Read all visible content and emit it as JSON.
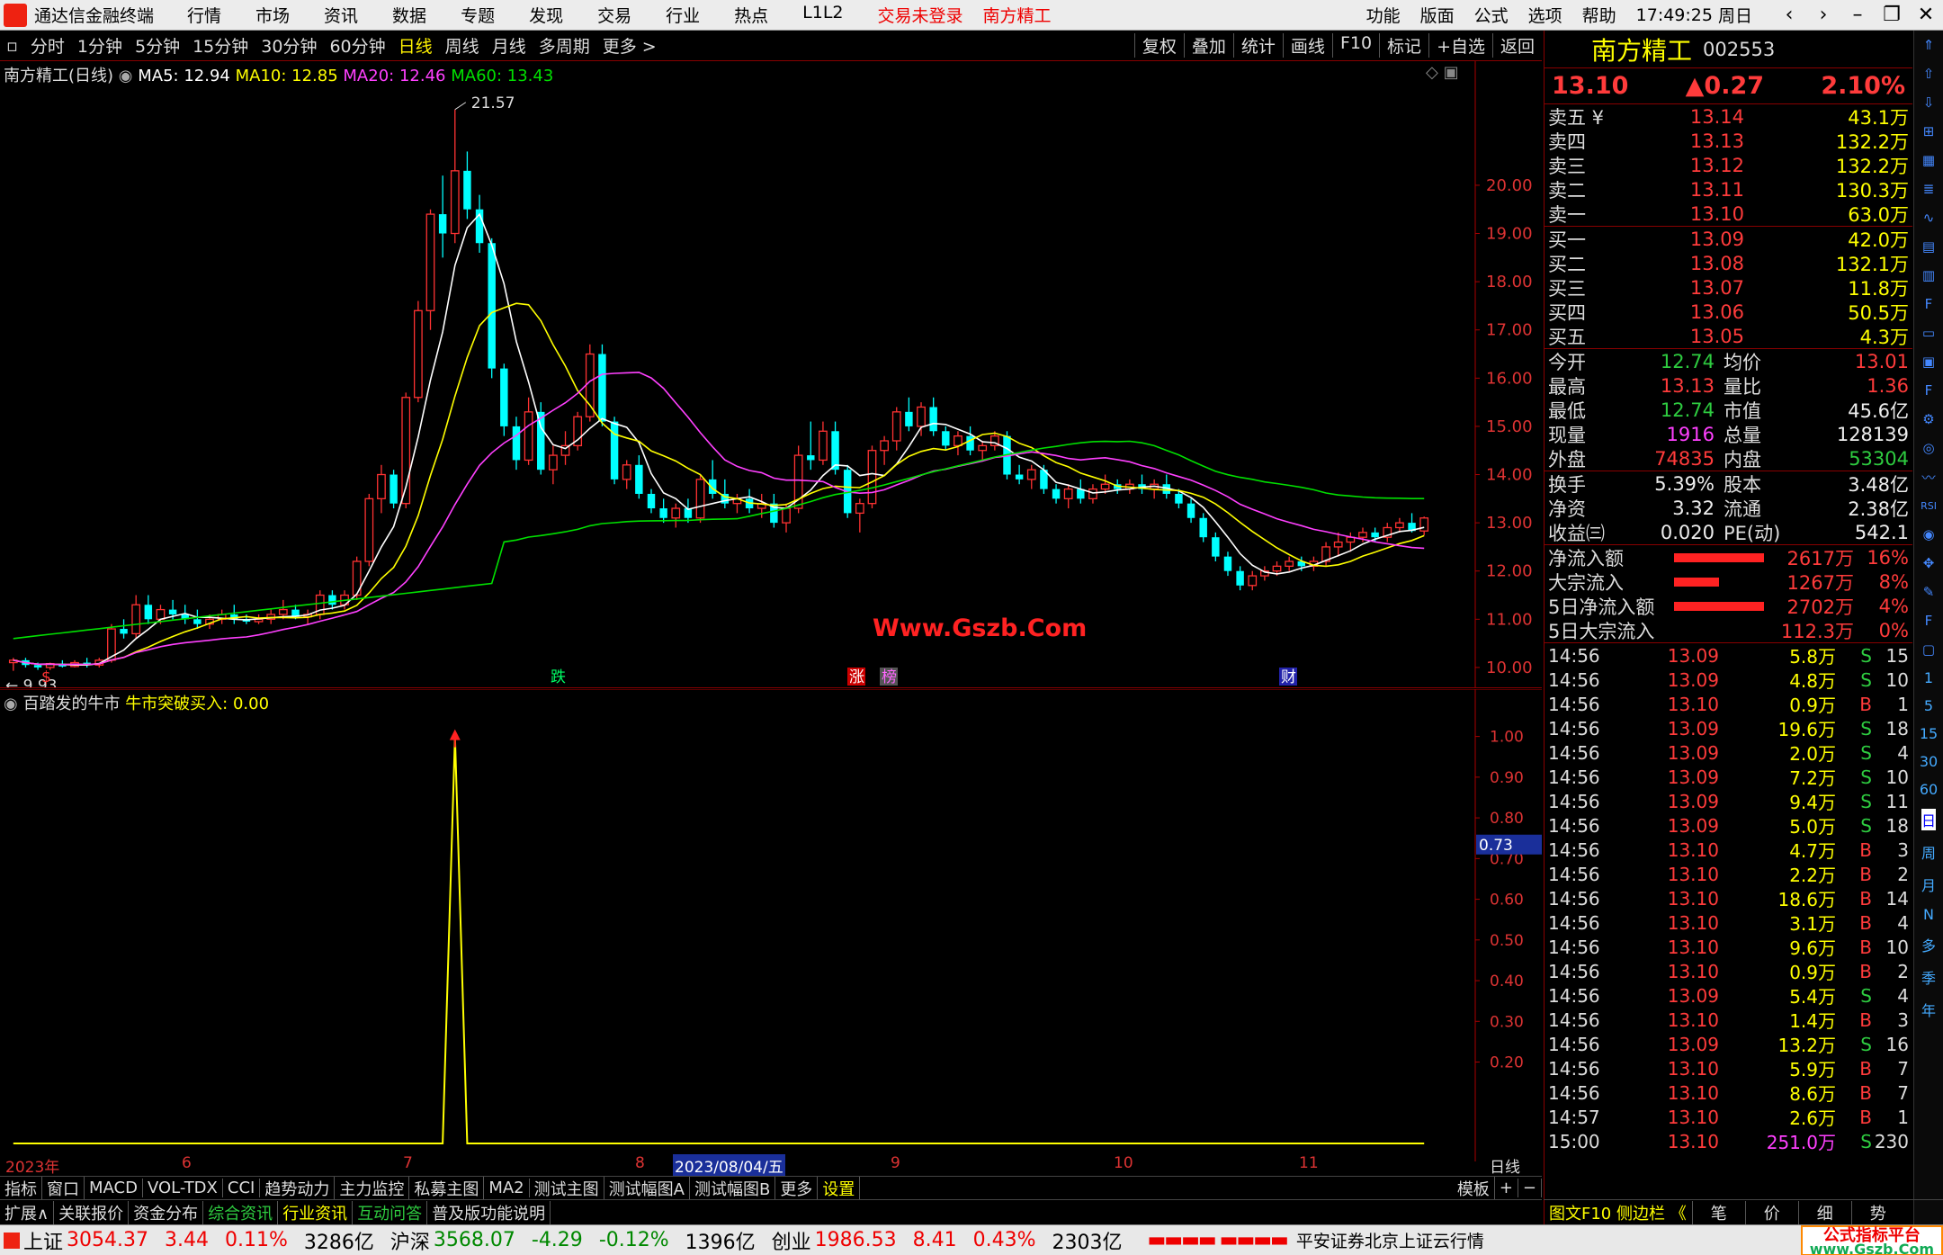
{
  "titlebar": {
    "app_name": "通达信金融终端",
    "menu": [
      "行情",
      "市场",
      "资讯",
      "数据",
      "专题",
      "发现",
      "交易",
      "行业",
      "热点",
      "L1L2"
    ],
    "status_warn": "交易未登录",
    "stock_name": "南方精工",
    "right_menu": [
      "功能",
      "版面",
      "公式",
      "选项",
      "帮助"
    ],
    "time": "17:49:25",
    "weekday": "周日"
  },
  "periodbar": {
    "items": [
      "分时",
      "1分钟",
      "5分钟",
      "15分钟",
      "30分钟",
      "60分钟",
      "日线",
      "周线",
      "月线",
      "多周期",
      "更多 >"
    ],
    "active": "日线",
    "right_buttons": [
      "复权",
      "叠加",
      "统计",
      "画线",
      "F10",
      "标记",
      "+自选",
      "返回"
    ]
  },
  "legend": {
    "title": "南方精工(日线)",
    "ma5": "MA5: 12.94",
    "ma10": "MA10: 12.85",
    "ma20": "MA20: 12.46",
    "ma60": "MA60: 13.43",
    "high_label": "21.57",
    "low_label": "9.93"
  },
  "markers": {
    "die": "跌",
    "zhang": "涨",
    "bang": "榜",
    "cai": "财",
    "s": "$"
  },
  "watermark": "Www.Gszb.Com",
  "sublegend": {
    "title": "百踏发的牛市",
    "indicator": "牛市突破买入: 0.00"
  },
  "sub_axis_current": "0.73",
  "xaxis": {
    "labels": [
      "2023年",
      "6",
      "7",
      "8",
      "2023/08/04/五",
      "9",
      "10",
      "11"
    ],
    "period_label": "日线"
  },
  "tabrow1": [
    "指标",
    "窗口",
    "MACD",
    "VOL-TDX",
    "CCI",
    "趋势动力",
    "主力监控",
    "私募主图",
    "MA2",
    "测试主图",
    "测试幅图A",
    "测试幅图B",
    "更多",
    "设置"
  ],
  "tabrow1_right": [
    "模板",
    "+",
    "−"
  ],
  "tabrow2": [
    "扩展∧",
    "关联报价",
    "资金分布",
    "综合资讯",
    "行业资讯",
    "互动问答",
    "普及版功能说明"
  ],
  "quote": {
    "name": "南方精工",
    "code": "002553",
    "price": "13.10",
    "change": "▲0.27",
    "pct": "2.10%",
    "sells": [
      {
        "label": "卖五 ¥",
        "price": "13.14",
        "vol": "43.1万"
      },
      {
        "label": "卖四",
        "price": "13.13",
        "vol": "132.2万"
      },
      {
        "label": "卖三",
        "price": "13.12",
        "vol": "132.2万"
      },
      {
        "label": "卖二",
        "price": "13.11",
        "vol": "130.3万"
      },
      {
        "label": "卖一",
        "price": "13.10",
        "vol": "63.0万"
      }
    ],
    "buys": [
      {
        "label": "买一",
        "price": "13.09",
        "vol": "42.0万"
      },
      {
        "label": "买二",
        "price": "13.08",
        "vol": "132.1万"
      },
      {
        "label": "买三",
        "price": "13.07",
        "vol": "11.8万"
      },
      {
        "label": "买四",
        "price": "13.06",
        "vol": "50.5万"
      },
      {
        "label": "买五",
        "price": "13.05",
        "vol": "4.3万"
      }
    ],
    "stats": [
      {
        "l": "今开",
        "a": "12.74",
        "l2": "均价",
        "b": "13.01"
      },
      {
        "l": "最高",
        "a": "13.13",
        "l2": "量比",
        "b": "1.36"
      },
      {
        "l": "最低",
        "a": "12.74",
        "l2": "市值",
        "b": "45.6亿"
      },
      {
        "l": "现量",
        "a": "1916",
        "l2": "总量",
        "b": "128139"
      },
      {
        "l": "外盘",
        "a": "74835",
        "l2": "内盘",
        "b": "53304"
      }
    ],
    "stats2": [
      {
        "l": "换手",
        "a": "5.39%",
        "l2": "股本",
        "b": "3.48亿"
      },
      {
        "l": "净资",
        "a": "3.32",
        "l2": "流通",
        "b": "2.38亿"
      },
      {
        "l": "收益㈢",
        "a": "0.020",
        "l2": "PE(动)",
        "b": "542.1"
      }
    ],
    "flows": [
      {
        "l": "净流入额",
        "a": "2617万",
        "b": "16%",
        "fill": 1.0
      },
      {
        "l": "大宗流入",
        "a": "1267万",
        "b": "8%",
        "fill": 0.5
      },
      {
        "l": "5日净流入额",
        "a": "2702万",
        "b": "4%",
        "fill": 1.0
      },
      {
        "l": "5日大宗流入",
        "a": "112.3万",
        "b": "0%",
        "fill": 0.0
      }
    ],
    "ticks": [
      {
        "t": "14:56",
        "p": "13.09",
        "v": "5.8万",
        "d": "S",
        "n": "15"
      },
      {
        "t": "14:56",
        "p": "13.09",
        "v": "4.8万",
        "d": "S",
        "n": "10"
      },
      {
        "t": "14:56",
        "p": "13.10",
        "v": "0.9万",
        "d": "B",
        "n": "1"
      },
      {
        "t": "14:56",
        "p": "13.09",
        "v": "19.6万",
        "d": "S",
        "n": "18"
      },
      {
        "t": "14:56",
        "p": "13.09",
        "v": "2.0万",
        "d": "S",
        "n": "4"
      },
      {
        "t": "14:56",
        "p": "13.09",
        "v": "7.2万",
        "d": "S",
        "n": "10"
      },
      {
        "t": "14:56",
        "p": "13.09",
        "v": "9.4万",
        "d": "S",
        "n": "11"
      },
      {
        "t": "14:56",
        "p": "13.09",
        "v": "5.0万",
        "d": "S",
        "n": "18"
      },
      {
        "t": "14:56",
        "p": "13.10",
        "v": "4.7万",
        "d": "B",
        "n": "3"
      },
      {
        "t": "14:56",
        "p": "13.10",
        "v": "2.2万",
        "d": "B",
        "n": "2"
      },
      {
        "t": "14:56",
        "p": "13.10",
        "v": "18.6万",
        "d": "B",
        "n": "14"
      },
      {
        "t": "14:56",
        "p": "13.10",
        "v": "3.1万",
        "d": "B",
        "n": "4"
      },
      {
        "t": "14:56",
        "p": "13.10",
        "v": "9.6万",
        "d": "B",
        "n": "10"
      },
      {
        "t": "14:56",
        "p": "13.10",
        "v": "0.9万",
        "d": "B",
        "n": "2"
      },
      {
        "t": "14:56",
        "p": "13.09",
        "v": "5.4万",
        "d": "S",
        "n": "4"
      },
      {
        "t": "14:56",
        "p": "13.10",
        "v": "1.4万",
        "d": "B",
        "n": "3"
      },
      {
        "t": "14:56",
        "p": "13.09",
        "v": "13.2万",
        "d": "S",
        "n": "16"
      },
      {
        "t": "14:56",
        "p": "13.10",
        "v": "5.9万",
        "d": "B",
        "n": "7"
      },
      {
        "t": "14:56",
        "p": "13.10",
        "v": "8.6万",
        "d": "B",
        "n": "7"
      },
      {
        "t": "14:57",
        "p": "13.10",
        "v": "2.6万",
        "d": "B",
        "n": "1"
      },
      {
        "t": "15:00",
        "p": "13.10",
        "v": "251.0万",
        "d": "S",
        "n": "230"
      }
    ]
  },
  "iconstrip_text": [
    "1",
    "5",
    "15",
    "30",
    "60",
    "日",
    "周",
    "月",
    "N",
    "多",
    "季",
    "年"
  ],
  "iconstrip_active": "日",
  "rtabs": {
    "f10": "图文F10 侧边栏 《",
    "tabs": [
      "笔",
      "价",
      "细",
      "势"
    ]
  },
  "statusbar": {
    "idx1_name": "上证",
    "idx1_val": "3054.37",
    "idx1_chg": "3.44",
    "idx1_pct": "0.11%",
    "idx1_amt": "3286亿",
    "idx2_name": "沪深",
    "idx2_val": "3568.07",
    "idx2_chg": "-4.29",
    "idx2_pct": "-0.12%",
    "idx2_amt": "1396亿",
    "idx3_name": "创业",
    "idx3_val": "1986.53",
    "idx3_chg": "8.41",
    "idx3_pct": "0.43%",
    "idx3_amt": "2303亿",
    "server": "平安证券北京上证云行情",
    "badge": "公式指标平台",
    "badge_url": "www.Gszb.Com"
  },
  "chart_data": {
    "type": "candlestick",
    "y_range": [
      9.7,
      22.2
    ],
    "y_ticks": [
      "20.00",
      "19.00",
      "18.00",
      "17.00",
      "16.00",
      "15.00",
      "14.00",
      "13.00",
      "12.00",
      "11.00",
      "10.00"
    ],
    "sub_y_ticks": [
      "1.00",
      "0.90",
      "0.80",
      "0.70",
      "0.60",
      "0.50",
      "0.40",
      "0.30",
      "0.20"
    ],
    "high": 21.57,
    "low": 9.93,
    "candles": [
      [
        10.1,
        10.2,
        9.93,
        10.15
      ],
      [
        10.15,
        10.2,
        10.0,
        10.05
      ],
      [
        10.05,
        10.1,
        9.95,
        10.0
      ],
      [
        10.0,
        10.1,
        9.95,
        10.08
      ],
      [
        10.08,
        10.15,
        10.0,
        10.02
      ],
      [
        10.02,
        10.15,
        10.0,
        10.1
      ],
      [
        10.1,
        10.2,
        10.0,
        10.05
      ],
      [
        10.05,
        10.2,
        10.0,
        10.15
      ],
      [
        10.15,
        10.9,
        10.1,
        10.8
      ],
      [
        10.8,
        11.0,
        10.6,
        10.7
      ],
      [
        10.7,
        11.5,
        10.6,
        11.3
      ],
      [
        11.3,
        11.5,
        10.9,
        11.0
      ],
      [
        11.0,
        11.3,
        10.9,
        11.2
      ],
      [
        11.2,
        11.4,
        11.0,
        11.1
      ],
      [
        11.1,
        11.3,
        10.9,
        11.0
      ],
      [
        11.0,
        11.2,
        10.8,
        10.9
      ],
      [
        10.9,
        11.1,
        10.8,
        11.0
      ],
      [
        11.0,
        11.2,
        10.9,
        11.1
      ],
      [
        11.1,
        11.3,
        10.9,
        11.0
      ],
      [
        11.0,
        11.1,
        10.9,
        10.95
      ],
      [
        10.95,
        11.1,
        10.9,
        11.0
      ],
      [
        11.0,
        11.2,
        10.9,
        11.1
      ],
      [
        11.1,
        11.4,
        11.0,
        11.2
      ],
      [
        11.2,
        11.3,
        11.0,
        11.05
      ],
      [
        11.05,
        11.2,
        10.9,
        11.1
      ],
      [
        11.1,
        11.6,
        11.0,
        11.5
      ],
      [
        11.5,
        11.6,
        11.2,
        11.3
      ],
      [
        11.3,
        11.6,
        11.2,
        11.5
      ],
      [
        11.5,
        12.3,
        11.4,
        12.2
      ],
      [
        12.2,
        13.6,
        12.1,
        13.5
      ],
      [
        13.5,
        14.2,
        13.2,
        14.0
      ],
      [
        14.0,
        14.1,
        13.3,
        13.4
      ],
      [
        13.4,
        15.7,
        13.3,
        15.6
      ],
      [
        15.6,
        17.6,
        15.5,
        17.4
      ],
      [
        17.4,
        19.5,
        17.0,
        19.4
      ],
      [
        19.4,
        20.2,
        18.5,
        19.0
      ],
      [
        19.0,
        21.57,
        18.8,
        20.3
      ],
      [
        20.3,
        20.7,
        19.3,
        19.5
      ],
      [
        19.5,
        19.8,
        18.6,
        18.8
      ],
      [
        18.8,
        18.9,
        16.0,
        16.2
      ],
      [
        16.2,
        16.3,
        14.8,
        15.0
      ],
      [
        15.0,
        15.2,
        14.1,
        14.3
      ],
      [
        14.3,
        15.6,
        14.2,
        15.3
      ],
      [
        15.3,
        15.5,
        14.0,
        14.1
      ],
      [
        14.1,
        14.6,
        13.8,
        14.4
      ],
      [
        14.4,
        14.9,
        14.2,
        14.6
      ],
      [
        14.6,
        15.3,
        14.5,
        15.2
      ],
      [
        15.2,
        16.7,
        15.1,
        16.5
      ],
      [
        16.5,
        16.7,
        15.0,
        15.1
      ],
      [
        15.1,
        15.2,
        13.8,
        13.9
      ],
      [
        13.9,
        14.3,
        13.7,
        14.2
      ],
      [
        14.2,
        14.4,
        13.5,
        13.6
      ],
      [
        13.6,
        13.7,
        13.2,
        13.3
      ],
      [
        13.3,
        13.5,
        13.0,
        13.1
      ],
      [
        13.1,
        13.4,
        12.9,
        13.3
      ],
      [
        13.3,
        13.5,
        13.0,
        13.1
      ],
      [
        13.1,
        14.0,
        13.0,
        13.9
      ],
      [
        13.9,
        14.3,
        13.5,
        13.6
      ],
      [
        13.6,
        13.9,
        13.3,
        13.4
      ],
      [
        13.4,
        13.6,
        13.2,
        13.5
      ],
      [
        13.5,
        13.7,
        13.2,
        13.3
      ],
      [
        13.3,
        13.6,
        13.1,
        13.4
      ],
      [
        13.4,
        13.6,
        12.9,
        13.0
      ],
      [
        13.0,
        13.4,
        12.8,
        13.3
      ],
      [
        13.3,
        14.6,
        13.2,
        14.4
      ],
      [
        14.4,
        15.1,
        14.1,
        14.3
      ],
      [
        14.3,
        15.1,
        14.2,
        14.9
      ],
      [
        14.9,
        15.1,
        14.0,
        14.1
      ],
      [
        14.1,
        14.2,
        13.1,
        13.2
      ],
      [
        13.2,
        13.5,
        12.8,
        13.4
      ],
      [
        13.4,
        14.6,
        13.3,
        14.5
      ],
      [
        14.5,
        14.8,
        14.2,
        14.7
      ],
      [
        14.7,
        15.4,
        14.5,
        15.3
      ],
      [
        15.3,
        15.6,
        14.9,
        15.0
      ],
      [
        15.0,
        15.5,
        14.8,
        15.4
      ],
      [
        15.4,
        15.6,
        14.8,
        14.9
      ],
      [
        14.9,
        15.0,
        14.5,
        14.6
      ],
      [
        14.6,
        14.9,
        14.4,
        14.8
      ],
      [
        14.8,
        15.0,
        14.4,
        14.5
      ],
      [
        14.5,
        14.7,
        14.3,
        14.6
      ],
      [
        14.6,
        14.9,
        14.5,
        14.8
      ],
      [
        14.8,
        14.9,
        13.9,
        14.0
      ],
      [
        14.0,
        14.2,
        13.8,
        13.9
      ],
      [
        13.9,
        14.2,
        13.7,
        14.1
      ],
      [
        14.1,
        14.2,
        13.6,
        13.7
      ],
      [
        13.7,
        13.8,
        13.4,
        13.5
      ],
      [
        13.5,
        13.8,
        13.3,
        13.7
      ],
      [
        13.7,
        13.9,
        13.4,
        13.5
      ],
      [
        13.5,
        13.8,
        13.4,
        13.7
      ],
      [
        13.7,
        14.0,
        13.6,
        13.8
      ],
      [
        13.8,
        13.9,
        13.6,
        13.7
      ],
      [
        13.7,
        13.9,
        13.6,
        13.8
      ],
      [
        13.8,
        14.0,
        13.6,
        13.7
      ],
      [
        13.7,
        13.9,
        13.5,
        13.8
      ],
      [
        13.8,
        14.0,
        13.5,
        13.6
      ],
      [
        13.6,
        13.7,
        13.3,
        13.4
      ],
      [
        13.4,
        13.5,
        13.0,
        13.1
      ],
      [
        13.1,
        13.2,
        12.6,
        12.7
      ],
      [
        12.7,
        12.8,
        12.2,
        12.3
      ],
      [
        12.3,
        12.4,
        11.9,
        12.0
      ],
      [
        12.0,
        12.1,
        11.6,
        11.7
      ],
      [
        11.7,
        12.0,
        11.6,
        11.9
      ],
      [
        11.9,
        12.1,
        11.8,
        12.0
      ],
      [
        12.0,
        12.2,
        11.9,
        12.1
      ],
      [
        12.1,
        12.3,
        12.0,
        12.2
      ],
      [
        12.2,
        12.3,
        12.0,
        12.1
      ],
      [
        12.1,
        12.3,
        12.0,
        12.2
      ],
      [
        12.2,
        12.6,
        12.1,
        12.5
      ],
      [
        12.5,
        12.8,
        12.3,
        12.6
      ],
      [
        12.6,
        12.8,
        12.4,
        12.7
      ],
      [
        12.7,
        12.9,
        12.6,
        12.8
      ],
      [
        12.8,
        12.9,
        12.6,
        12.7
      ],
      [
        12.7,
        13.0,
        12.6,
        12.9
      ],
      [
        12.9,
        13.1,
        12.8,
        13.0
      ],
      [
        13.0,
        13.2,
        12.8,
        12.83
      ],
      [
        12.83,
        13.13,
        12.74,
        13.1
      ]
    ],
    "ma": {
      "MA5": "#ffffff",
      "MA10": "#ffff00",
      "MA20": "#ff40ff",
      "MA60": "#00e000"
    },
    "sub_signal_index": 36
  }
}
